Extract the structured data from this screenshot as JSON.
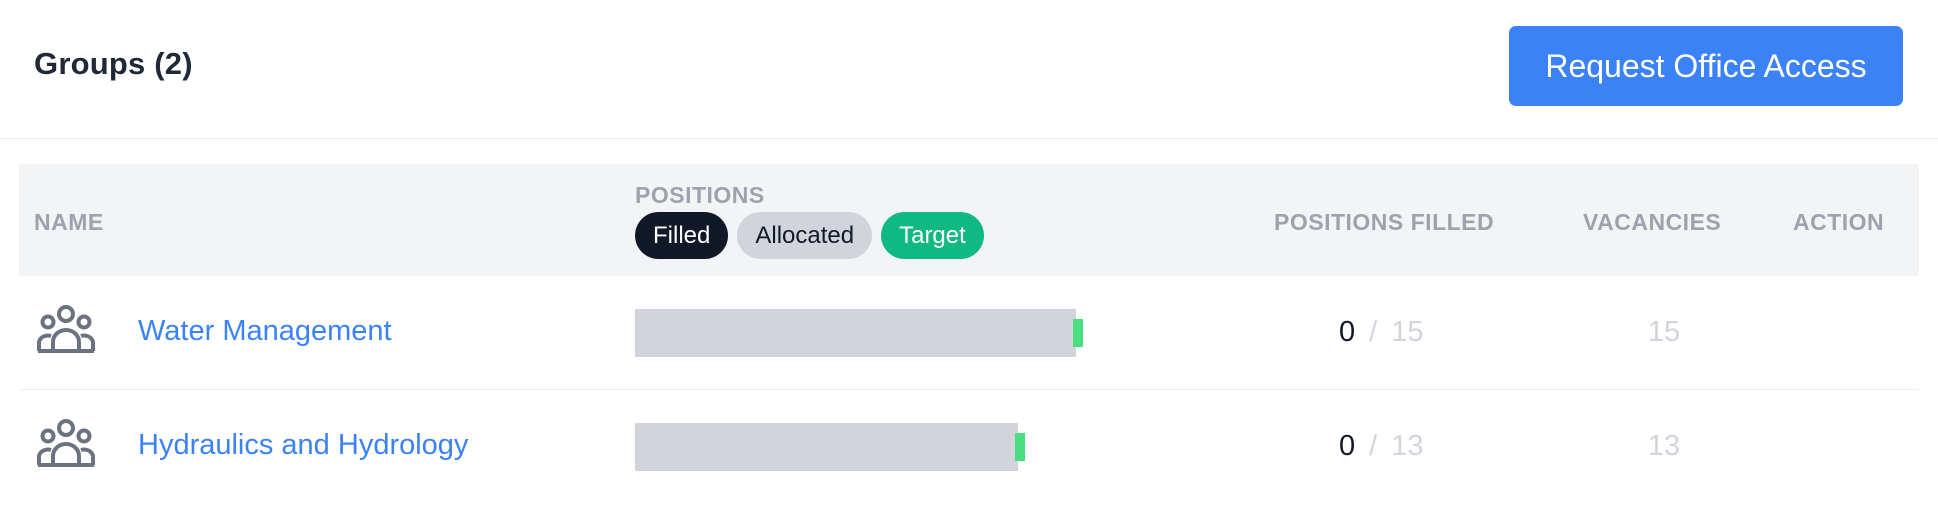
{
  "header": {
    "title": "Groups (2)",
    "request_button": "Request Office Access"
  },
  "table": {
    "columns": {
      "name": "NAME",
      "positions": "POSITIONS",
      "positions_filled": "POSITIONS FILLED",
      "vacancies": "VACANCIES",
      "action": "ACTION"
    },
    "legend": {
      "filled": "Filled",
      "allocated": "Allocated",
      "target": "Target"
    },
    "rows": [
      {
        "name": "Water Management",
        "filled": "0",
        "separator": "/",
        "total": "15",
        "vacancies": "15",
        "icon": "users-group-icon"
      },
      {
        "name": "Hydraulics and Hydrology",
        "filled": "0",
        "separator": "/",
        "total": "13",
        "vacancies": "13",
        "icon": "users-group-icon"
      }
    ]
  },
  "colors": {
    "accent": "#3b82f6",
    "filled": "#111827",
    "allocated": "#d1d5db",
    "target": "#10b981",
    "target_marker": "#4ade80"
  }
}
